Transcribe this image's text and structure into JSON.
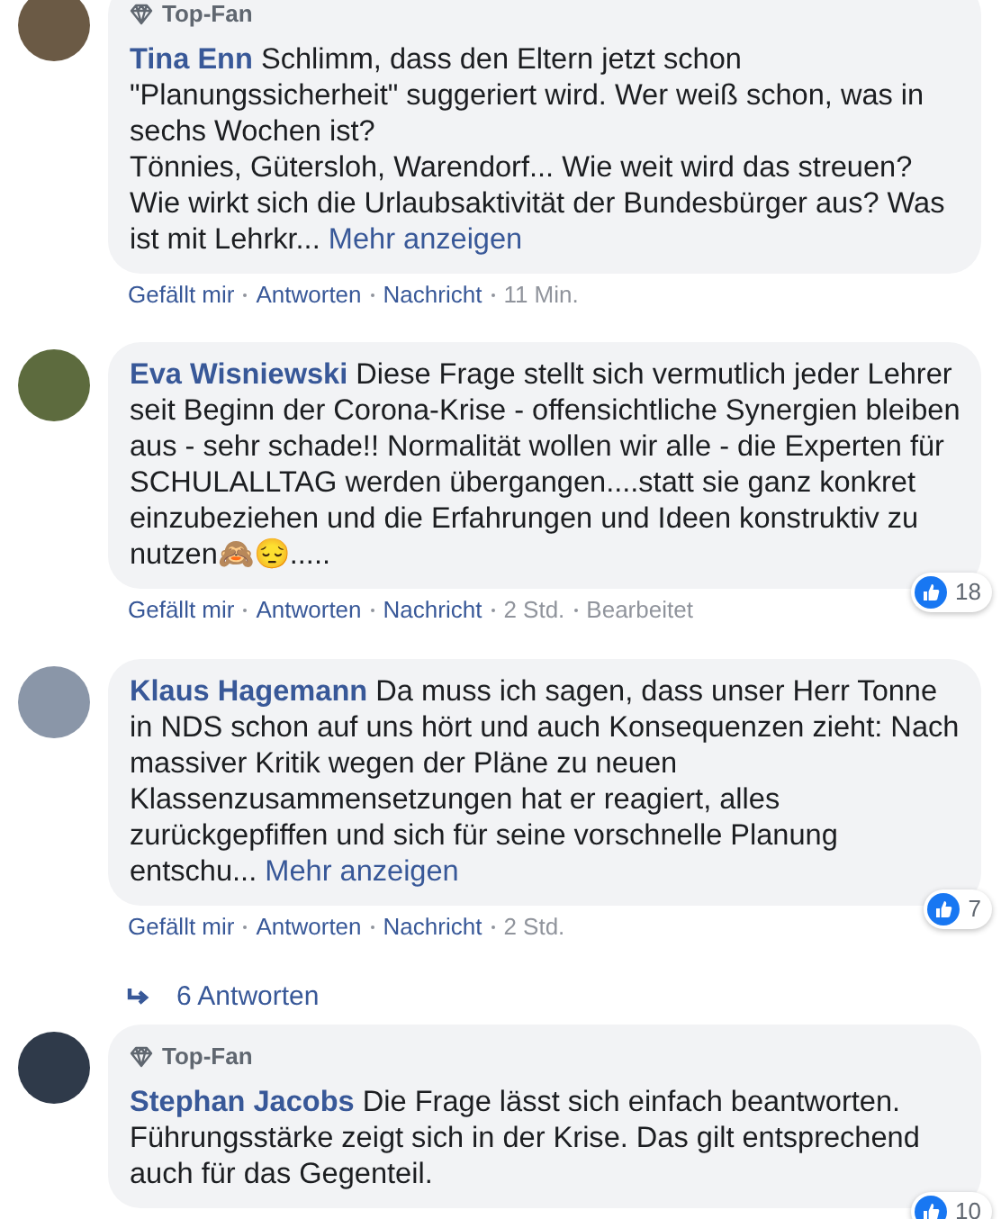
{
  "comments": [
    {
      "badge": "Top-Fan",
      "author": "Tina Enn",
      "text": "Schlimm, dass den Eltern jetzt schon \"Planungssicherheit\" suggeriert wird. Wer weiß schon, was in sechs Wochen ist?\nTönnies, Gütersloh, Warendorf... Wie weit wird das streuen? Wie wirkt sich die Urlaubsaktivität der Bundesbürger aus? Was ist mit Lehrkr...",
      "more": "Mehr anzeigen",
      "actions": [
        "Gefällt mir",
        "Antworten",
        "Nachricht"
      ],
      "time": "11 Min."
    },
    {
      "author": "Eva Wisniewski",
      "text": "Diese Frage stellt sich vermutlich jeder Lehrer seit Beginn der Corona-Krise - offensichtliche Synergien bleiben aus - sehr schade!! Normalität wollen wir alle - die Experten für SCHULALLTAG werden übergangen....statt sie ganz konkret einzubeziehen und die Erfahrungen und Ideen konstruktiv zu nutzen🙈😔.....",
      "actions": [
        "Gefällt mir",
        "Antworten",
        "Nachricht"
      ],
      "time": "2 Std.",
      "edited": "Bearbeitet",
      "likes": "18"
    },
    {
      "author": "Klaus Hagemann",
      "text": "Da muss ich sagen, dass unser Herr Tonne in NDS schon auf uns hört und auch Konsequenzen zieht: Nach massiver Kritik wegen der Pläne zu neuen Klassenzusammensetzungen hat er reagiert, alles zurückgepfiffen und sich für seine vorschnelle Planung entschu...",
      "more": "Mehr anzeigen",
      "actions": [
        "Gefällt mir",
        "Antworten",
        "Nachricht"
      ],
      "time": "2 Std.",
      "likes": "7",
      "replies": "6 Antworten"
    },
    {
      "badge": "Top-Fan",
      "author": "Stephan Jacobs",
      "text": "Die Frage lässt sich einfach beantworten. Führungsstärke zeigt sich in der Krise. Das gilt entsprechend auch für das Gegenteil.",
      "likes": "10"
    }
  ]
}
